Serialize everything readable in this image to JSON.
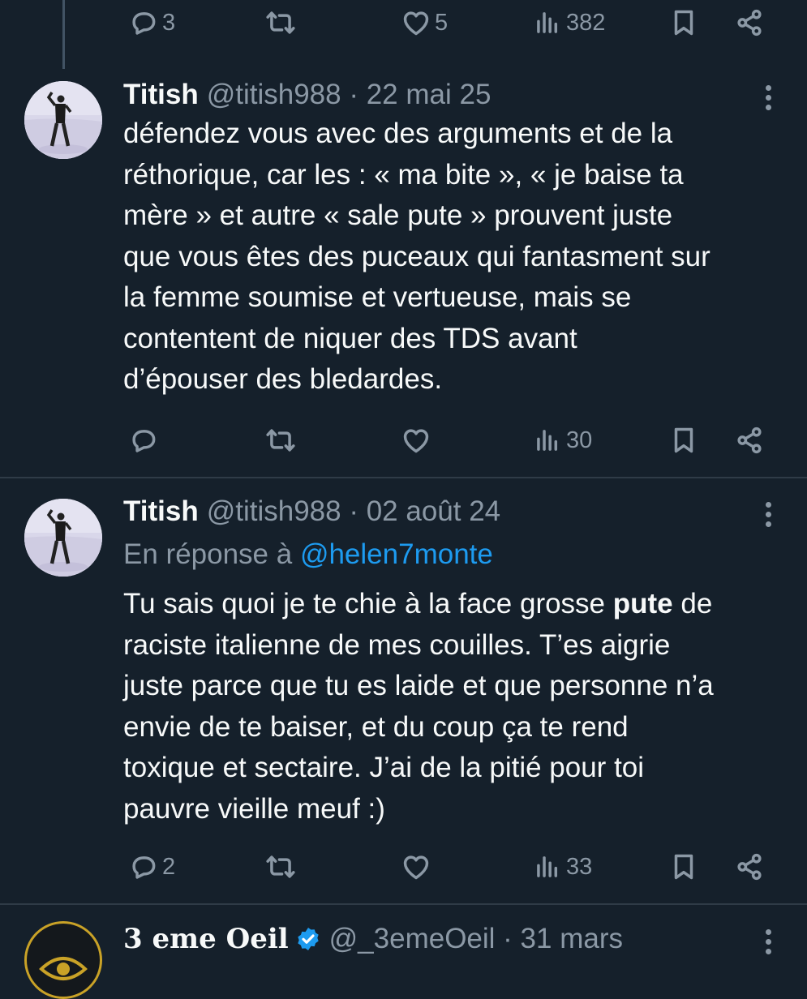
{
  "top_actions": {
    "reply_count": "3",
    "like_count": "5",
    "view_count": "382"
  },
  "tweet1": {
    "name": "Titish",
    "handle_date": "@titish988 · 22 mai 25",
    "lines": [
      "défendez vous avec des arguments et de la",
      "réthorique, car les : « ma bite », « je baise ta",
      "mère » et autre « sale pute » prouvent juste",
      "que vous êtes des puceaux qui fantasment sur",
      "la femme soumise et vertueuse, mais se",
      "contentent de niquer des TDS avant",
      "d’épouser des bledardes."
    ],
    "view_count": "30"
  },
  "tweet2": {
    "name": "Titish",
    "handle_date": "@titish988 · 02 août 24",
    "reply_prefix": "En réponse à ",
    "reply_mention": "@helen7monte",
    "line1_before": "Tu sais quoi je te chie à la face grosse ",
    "line1_bold": "pute",
    "line1_after": " de",
    "lines": [
      "raciste italienne de mes couilles. T’es aigrie",
      "juste parce que tu es laide et que personne n’a",
      "envie de te baiser, et du coup ça te rend",
      "toxique et sectaire. J’ai de la pitié pour toi",
      "pauvre vieille meuf :)"
    ],
    "reply_count": "2",
    "view_count": "33"
  },
  "tweet3": {
    "name": "3 eme Oeil",
    "handle_date": "@_3emeOeil · 31 mars"
  },
  "colors": {
    "background": "#15202b",
    "text": "#f7f9f9",
    "muted": "#8b98a5",
    "accent": "#1d9bf0",
    "divider": "#2f3b47"
  }
}
